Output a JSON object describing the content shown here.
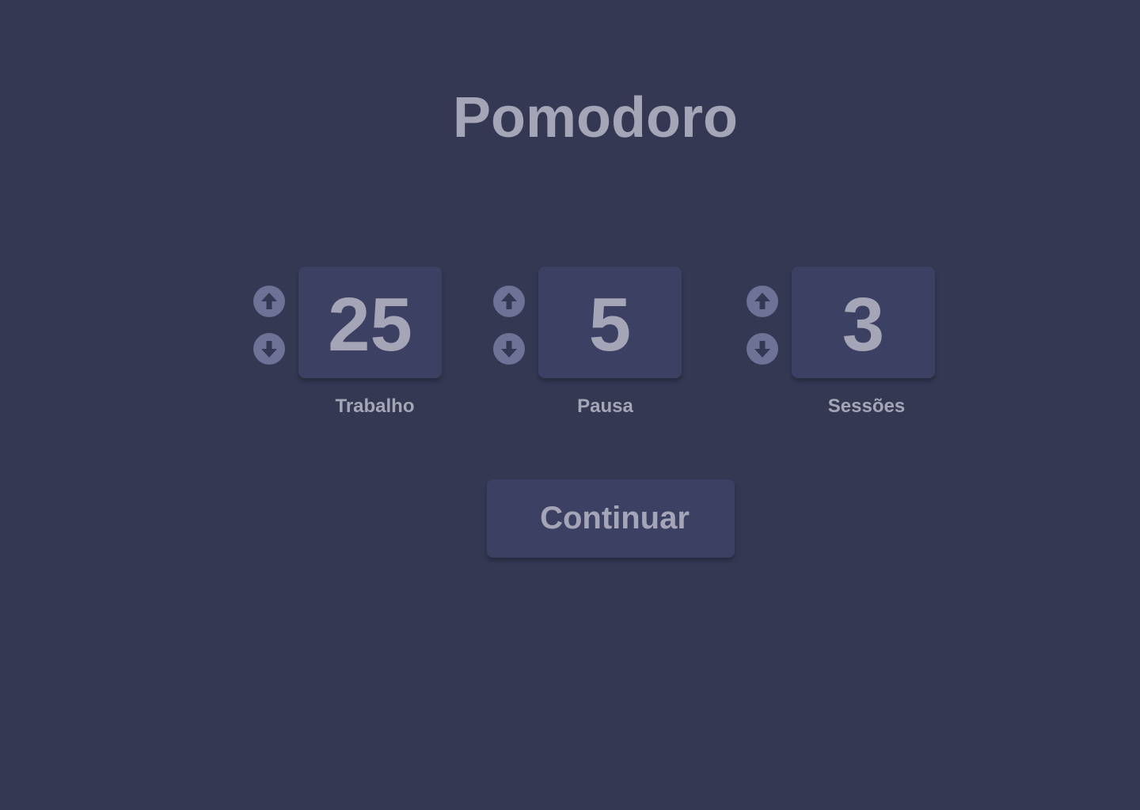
{
  "app": {
    "title": "Pomodoro"
  },
  "colors": {
    "background": "#343853",
    "card": "#3c4163",
    "text": "#a4a5b6",
    "stepper": "#6e7296"
  },
  "settings": [
    {
      "label": "Trabalho",
      "value": "25",
      "increment_icon": "arrow-up-icon",
      "decrement_icon": "arrow-down-icon"
    },
    {
      "label": "Pausa",
      "value": "5",
      "increment_icon": "arrow-up-icon",
      "decrement_icon": "arrow-down-icon"
    },
    {
      "label": "Sessões",
      "value": "3",
      "increment_icon": "arrow-up-icon",
      "decrement_icon": "arrow-down-icon"
    }
  ],
  "actions": {
    "continue_label": "Continuar"
  }
}
